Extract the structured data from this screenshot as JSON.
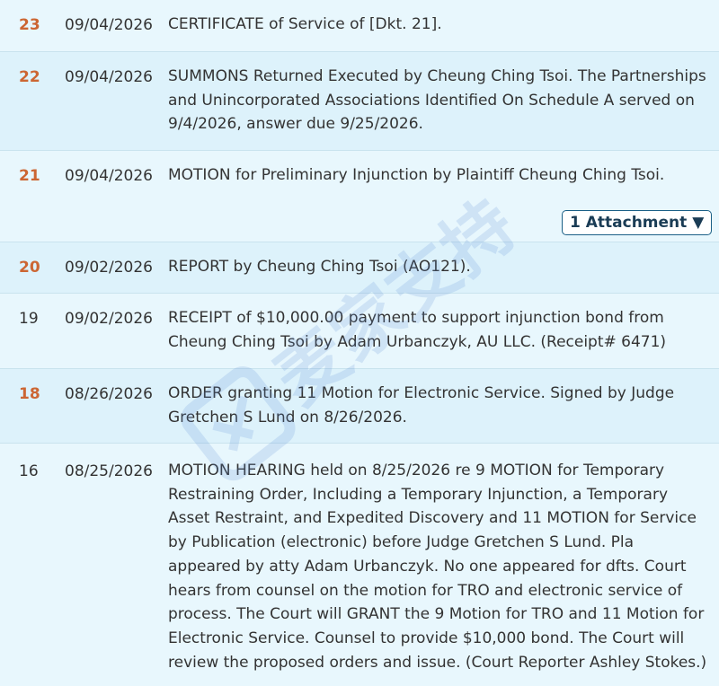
{
  "entries": [
    {
      "num": "23",
      "date": "09/04/2026",
      "text": "CERTIFICATE of Service of [Dkt. 21]."
    },
    {
      "num": "22",
      "date": "09/04/2026",
      "text": "SUMMONS Returned Executed by Cheung Ching Tsoi. The Partnerships and Unincorporated Associations Identified On Schedule A served on 9/4/2026, answer due 9/25/2026."
    },
    {
      "num": "21",
      "date": "09/04/2026",
      "text": "MOTION for Preliminary Injunction by Plaintiff Cheung Ching Tsoi.",
      "attachment_label": "1 Attachment ▼"
    },
    {
      "num": "20",
      "date": "09/02/2026",
      "text": "REPORT by Cheung Ching Tsoi (AO121)."
    },
    {
      "num": "19",
      "date": "09/02/2026",
      "text": "RECEIPT of $10,000.00 payment to support injunction bond from Cheung Ching Tsoi by Adam Urbanczyk, AU LLC. (Receipt# 6471)"
    },
    {
      "num": "18",
      "date": "08/26/2026",
      "text": "ORDER granting 11 Motion for Electronic Service. Signed by Judge Gretchen S Lund on 8/26/2026."
    },
    {
      "num": "16",
      "date": "08/25/2026",
      "text": "MOTION HEARING held on 8/25/2026 re 9 MOTION for Temporary Restraining Order, Including a Temporary Injunction, a Temporary Asset Restraint, and Expedited Discovery and 11 MOTION for Service by Publication (electronic) before Judge Gretchen S Lund. Pla appeared by atty Adam Urbanczyk. No one appeared for dfts. Court hears from counsel on the motion for TRO and electronic service of process. The Court will GRANT the 9 Motion for TRO and 11 Motion for Electronic Service. Counsel to provide $10,000 bond. The Court will review the proposed orders and issue. (Court Reporter Ashley Stokes.)"
    }
  ],
  "watermark_text": "麦家支持",
  "colors": {
    "link_number": "#cc6633",
    "row_bg": "#e8f7fd",
    "row_alt_bg": "#ddf2fb",
    "border": "#c9e3ee"
  }
}
